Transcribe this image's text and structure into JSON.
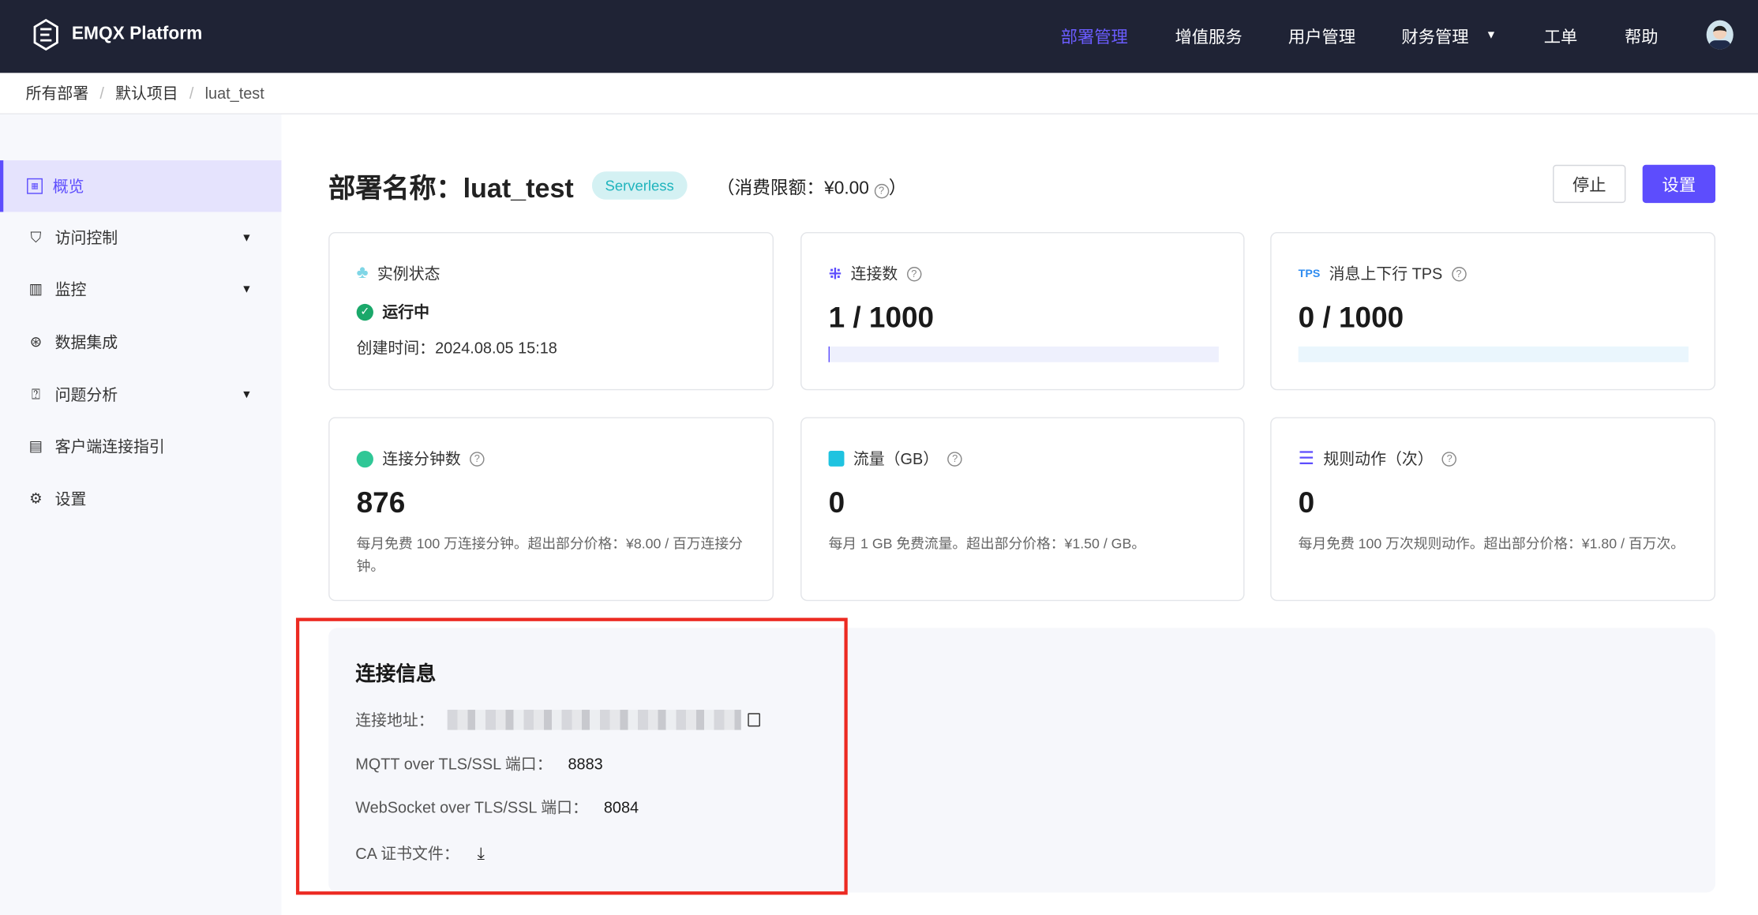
{
  "header": {
    "brand": "EMQX Platform",
    "nav": [
      {
        "label": "部署管理",
        "active": true
      },
      {
        "label": "增值服务"
      },
      {
        "label": "用户管理"
      },
      {
        "label": "财务管理",
        "dropdown": true
      },
      {
        "label": "工单"
      },
      {
        "label": "帮助"
      }
    ],
    "accent": "#5d4dfd"
  },
  "breadcrumb": [
    "所有部署",
    "默认项目",
    "luat_test"
  ],
  "sidebar": {
    "items": [
      {
        "label": "概览",
        "icon": "dashboard-icon",
        "active": true
      },
      {
        "label": "访问控制",
        "icon": "shield-icon",
        "dropdown": true
      },
      {
        "label": "监控",
        "icon": "chart-icon",
        "dropdown": true
      },
      {
        "label": "数据集成",
        "icon": "integration-icon"
      },
      {
        "label": "问题分析",
        "icon": "doc-question-icon",
        "dropdown": true
      },
      {
        "label": "客户端连接指引",
        "icon": "client-guide-icon"
      },
      {
        "label": "设置",
        "icon": "gear-icon"
      }
    ]
  },
  "deployment": {
    "title": "部署名称：luat_test",
    "badge": "Serverless",
    "limit": "（消费限额：¥0.00",
    "limit_close": "）",
    "stop": "停止",
    "settings": "设置"
  },
  "cards": [
    {
      "label": "实例状态",
      "status": "运行中",
      "created": "创建时间：2024.08.05 15:18",
      "status_color": "#1aa86a"
    },
    {
      "label": "连接数",
      "value": "1 / 1000",
      "progress": 0.001
    },
    {
      "label": "消息上下行 TPS",
      "icon_text": "TPS",
      "value": "0 / 1000",
      "progress": 0
    },
    {
      "label": "连接分钟数",
      "value": "876",
      "desc": "每月免费 100 万连接分钟。超出部分价格：¥8.00 / 百万连接分钟。"
    },
    {
      "label": "流量（GB）",
      "value": "0",
      "desc": "每月 1 GB 免费流量。超出部分价格：¥1.50 / GB。"
    },
    {
      "label": "规则动作（次）",
      "value": "0",
      "desc": "每月免费 100 万次规则动作。超出部分价格：¥1.80 / 百万次。"
    }
  ],
  "connection": {
    "title": "连接信息",
    "address_label": "连接地址：",
    "mqtt_label": "MQTT over TLS/SSL 端口：",
    "mqtt_port": "8883",
    "ws_label": "WebSocket over TLS/SSL 端口：",
    "ws_port": "8084",
    "ca_label": "CA 证书文件："
  }
}
